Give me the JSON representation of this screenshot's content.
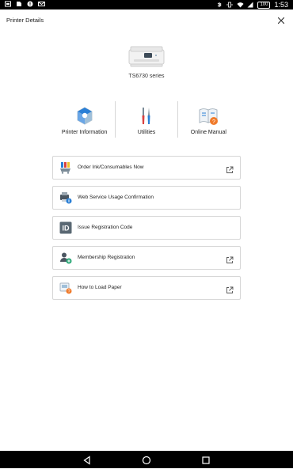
{
  "status_bar": {
    "battery": "100",
    "time": "1:53"
  },
  "header": {
    "title": "Printer Details"
  },
  "printer": {
    "model": "TS6730 series"
  },
  "actions": [
    {
      "label": "Printer Information",
      "icon": "printer-information-icon"
    },
    {
      "label": "Utilities",
      "icon": "utilities-icon"
    },
    {
      "label": "Online Manual",
      "icon": "online-manual-icon"
    }
  ],
  "list": [
    {
      "label": "Order Ink/Consumables Now",
      "icon": "ink-cart-icon",
      "external": true
    },
    {
      "label": "Web Service Usage Confirmation",
      "icon": "printer-info-icon",
      "external": false
    },
    {
      "label": "Issue Registration Code",
      "icon": "id-icon",
      "external": false
    },
    {
      "label": "Membership Registration",
      "icon": "add-member-icon",
      "external": true
    },
    {
      "label": "How to Load Paper",
      "icon": "load-paper-icon",
      "external": true
    }
  ],
  "colors": {
    "accent_blue": "#2a7fd6",
    "accent_orange": "#f07a2a",
    "accent_red": "#d94140",
    "id_gray": "#5a6873",
    "border": "#d6d6d6"
  }
}
